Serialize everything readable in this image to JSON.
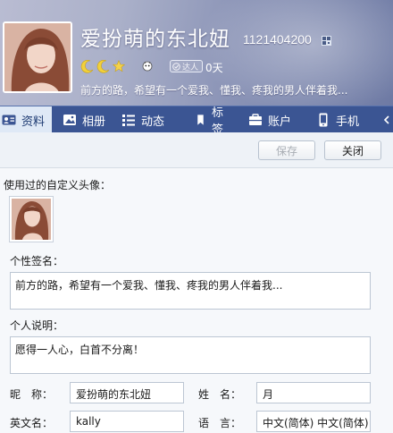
{
  "profile": {
    "nickname": "爱扮萌的东北妞",
    "qq_number": "1121404200",
    "expert_badge": "达人",
    "active_days": "0天",
    "signature": "前方的路，希望有一个爱我、懂我、疼我的男人伴着我..."
  },
  "tabs": [
    {
      "label": "资料",
      "icon": "id-card-icon",
      "active": true
    },
    {
      "label": "相册",
      "icon": "photo-icon",
      "active": false
    },
    {
      "label": "动态",
      "icon": "feed-icon",
      "active": false
    },
    {
      "label": "标签",
      "icon": "bookmark-icon",
      "active": false
    },
    {
      "label": "账户",
      "icon": "wallet-icon",
      "active": false
    },
    {
      "label": "手机",
      "icon": "phone-icon",
      "active": false
    }
  ],
  "toolbar": {
    "save_label": "保存",
    "close_label": "关闭"
  },
  "content": {
    "avatar_history_label": "使用过的自定义头像：",
    "signature_label": "个性签名：",
    "signature_value": "前方的路，希望有一个爱我、懂我、疼我的男人伴着我...",
    "description_label": "个人说明：",
    "description_value": "愿得一人心，白首不分离！",
    "nickname_label": "昵　称：",
    "nickname_value": "爱扮萌的东北妞",
    "surname_label": "姓　名：",
    "surname_value": "月",
    "english_name_label": "英文名：",
    "english_name_value": "kally",
    "language_label": "语　言：",
    "language_value": "中文(简体) 中文(简体)"
  },
  "colors": {
    "tabbar": "#3b5593",
    "active_tab": "#dfe9f6",
    "moon": "#f2d13a"
  }
}
